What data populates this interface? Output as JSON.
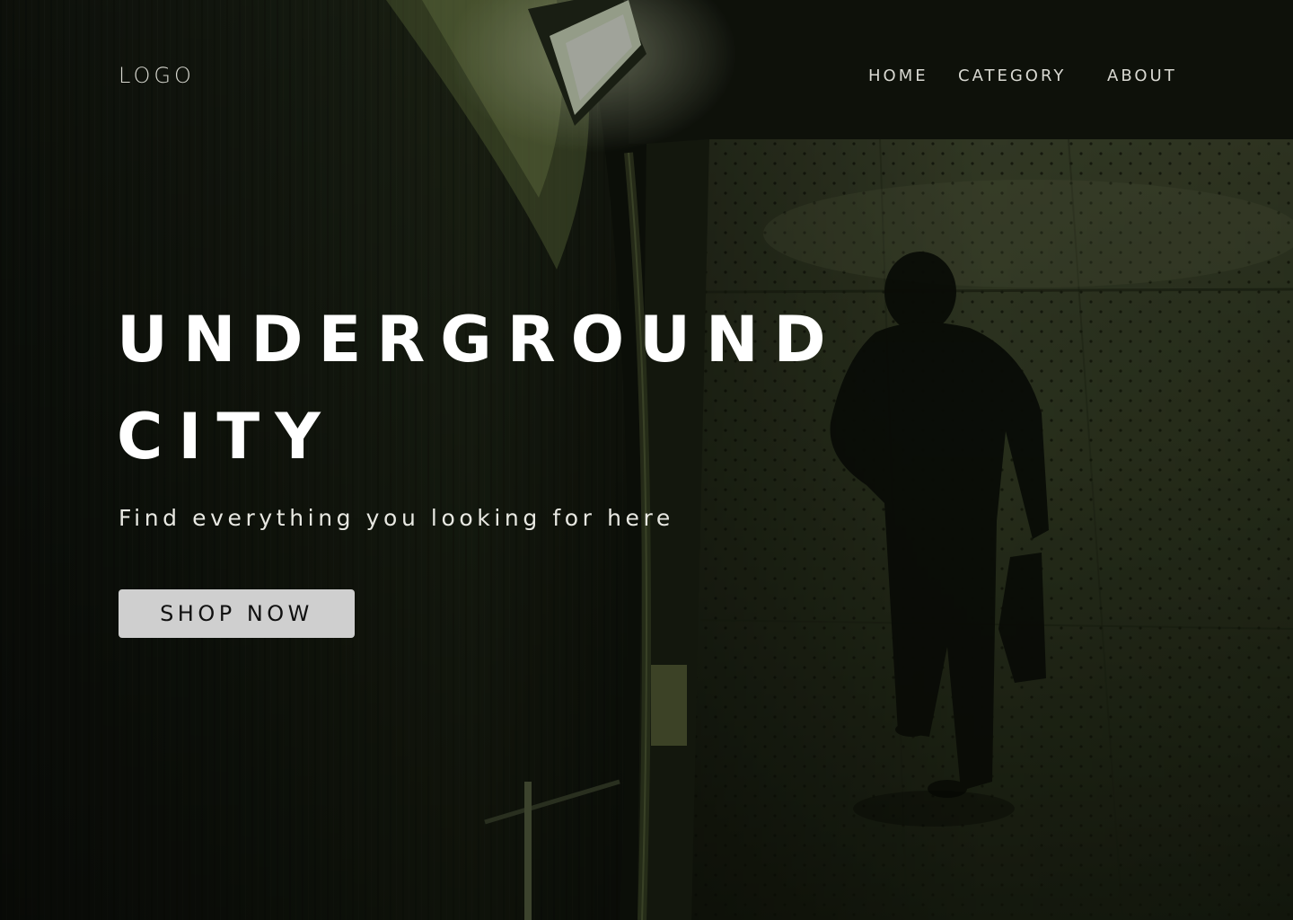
{
  "header": {
    "logo": "LOGO",
    "nav": [
      {
        "label": "HOME"
      },
      {
        "label": "CATEGORY"
      },
      {
        "label": "ABOUT"
      }
    ]
  },
  "hero": {
    "title_line1": "UNDERGROUND",
    "title_line2": "CITY",
    "subtitle": "Find everything you looking for here",
    "cta_label": "SHOP NOW"
  },
  "colors": {
    "button_bg": "#cfcfcf",
    "button_text": "#111111",
    "title_text": "#ffffff",
    "overlay_tint": "#1a2410"
  }
}
